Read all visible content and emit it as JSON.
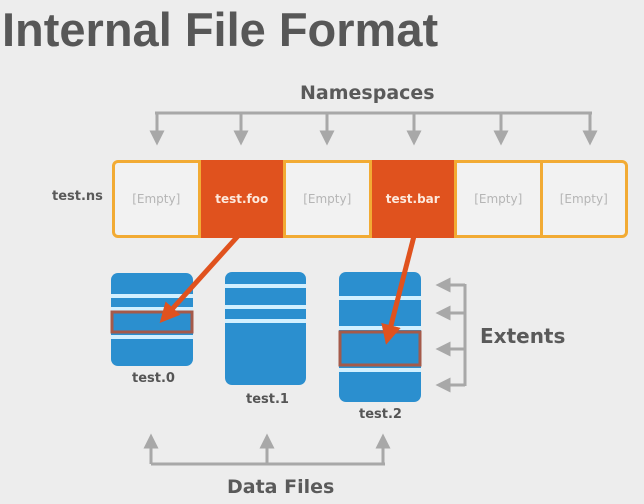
{
  "title": "Internal File Format",
  "labels": {
    "namespaces": "Namespaces",
    "extents": "Extents",
    "data_files": "Data Files",
    "ns_file": "test.ns"
  },
  "namespaces": [
    {
      "label": "[Empty]",
      "used": false
    },
    {
      "label": "test.foo",
      "used": true
    },
    {
      "label": "[Empty]",
      "used": false
    },
    {
      "label": "test.bar",
      "used": true
    },
    {
      "label": "[Empty]",
      "used": false
    },
    {
      "label": "[Empty]",
      "used": false
    }
  ],
  "data_files": [
    {
      "name": "test.0"
    },
    {
      "name": "test.1"
    },
    {
      "name": "test.2"
    }
  ],
  "pointers": [
    {
      "from_namespace": "test.foo",
      "to_file": "test.0"
    },
    {
      "from_namespace": "test.bar",
      "to_file": "test.2"
    }
  ],
  "colors": {
    "namespace_border": "#f2ab34",
    "namespace_used": "#e0521e",
    "file_block": "#2b8fcf",
    "extent_separator": "#d2f0ff",
    "highlight_border": "#a55a4a",
    "pointer_arrow": "#e0521e",
    "bracket_arrow": "#a8a8a8"
  }
}
